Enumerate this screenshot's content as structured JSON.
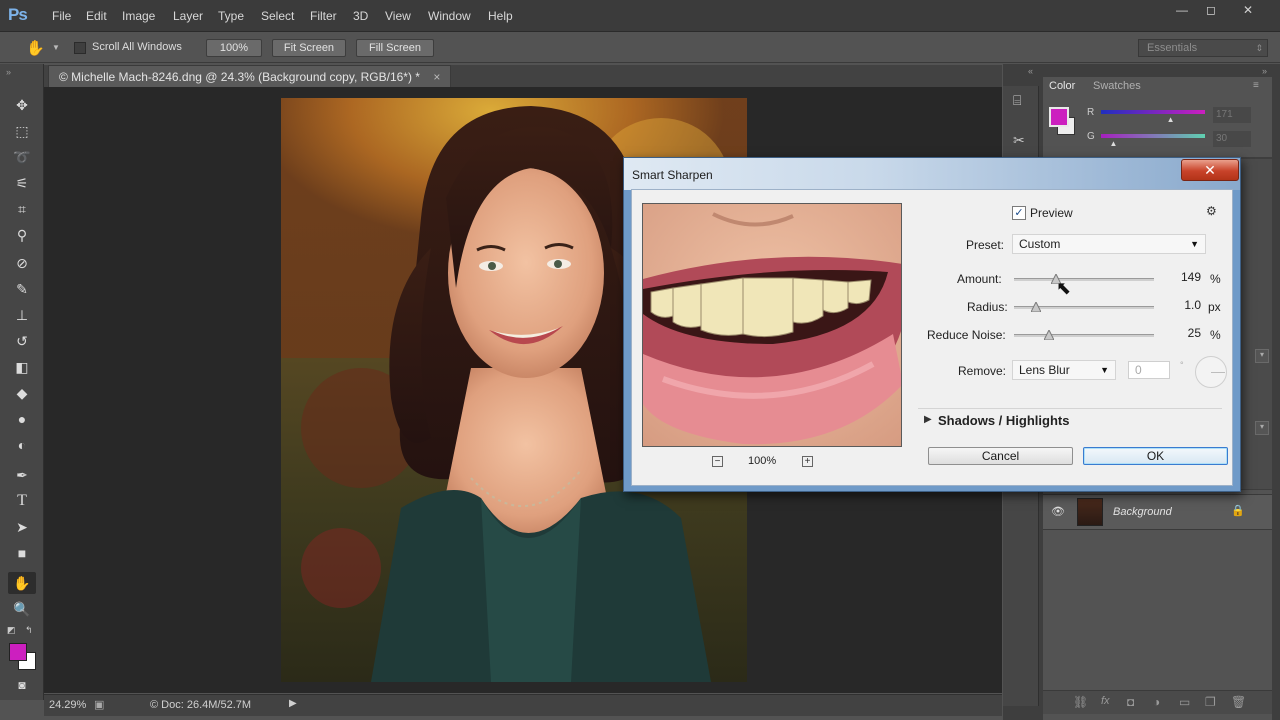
{
  "app": {
    "logo": "Ps",
    "menu": [
      "File",
      "Edit",
      "Image",
      "Layer",
      "Type",
      "Select",
      "Filter",
      "3D",
      "View",
      "Window",
      "Help"
    ]
  },
  "options_bar": {
    "scroll_all_windows": "Scroll All Windows",
    "zoom_100": "100%",
    "fit_screen": "Fit Screen",
    "fill_screen": "Fill Screen",
    "workspace": "Essentials"
  },
  "document": {
    "tab_title": "© Michelle Mach-8246.dng @ 24.3% (Background copy, RGB/16*) *",
    "tab_close": "×"
  },
  "status_bar": {
    "zoom": "24.29%",
    "doc_size": "© Doc: 26.4M/52.7M"
  },
  "color_panel": {
    "tabs": [
      "Color",
      "Swatches"
    ],
    "channels": [
      {
        "label": "R",
        "value": "171",
        "level": 0.67
      },
      {
        "label": "G",
        "value": "30",
        "level": 0.12
      }
    ],
    "foreground": "#cc1fbf"
  },
  "layers_panel": {
    "layer_name": "Background"
  },
  "dialog": {
    "title": "Smart Sharpen",
    "close": "✕",
    "preview_label": "Preview",
    "preview_checked": true,
    "preset_label": "Preset:",
    "preset_value": "Custom",
    "amount_label": "Amount:",
    "amount_value": "149",
    "amount_unit": "%",
    "amount_level": 0.3,
    "radius_label": "Radius:",
    "radius_value": "1.0",
    "radius_unit": "px",
    "radius_level": 0.16,
    "noise_label": "Reduce Noise:",
    "noise_value": "25",
    "noise_unit": "%",
    "noise_level": 0.25,
    "remove_label": "Remove:",
    "remove_value": "Lens Blur",
    "angle_value": "0",
    "angle_unit": "°",
    "shadows_label": "Shadows / Highlights",
    "zoom_value": "100%",
    "zoom_out": "−",
    "zoom_in": "+",
    "cancel_label": "Cancel",
    "ok_label": "OK"
  },
  "colors": {
    "accent_blue": "#6f9ac8",
    "close_red": "#c8432a",
    "foreground_swatch": "#cc1fbf"
  }
}
